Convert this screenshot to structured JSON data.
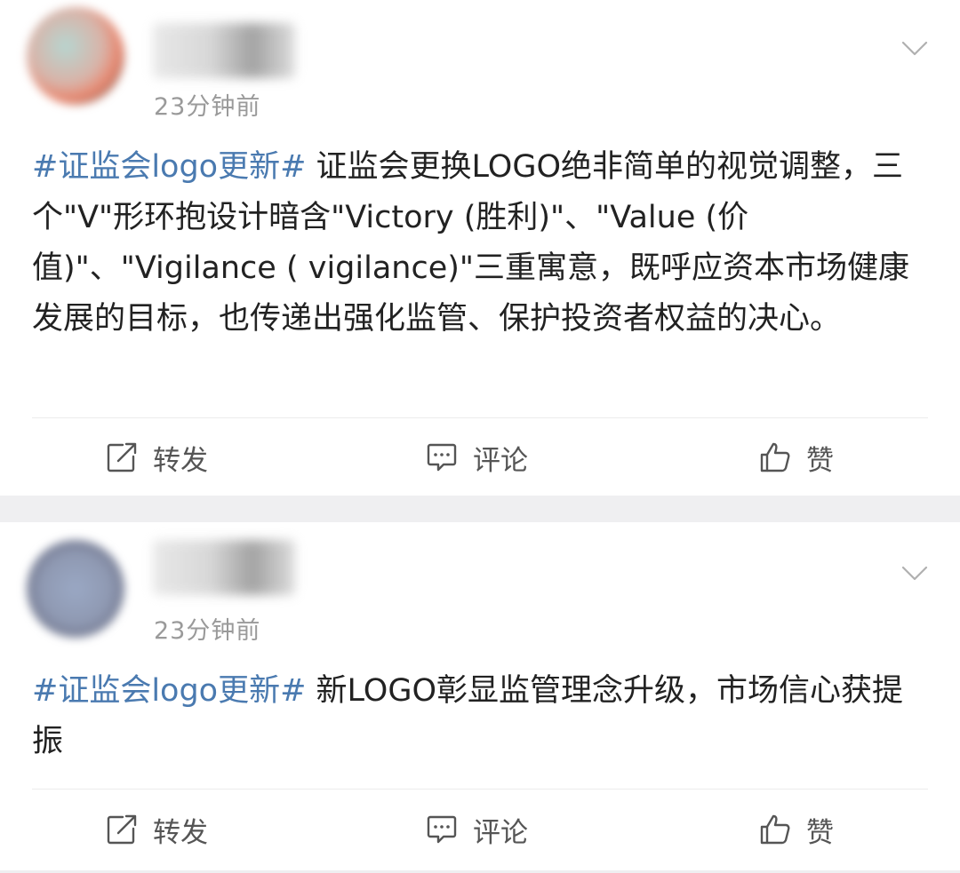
{
  "posts": [
    {
      "timestamp": "23分钟前",
      "hashtag": "#证监会logo更新#",
      "text": " 证监会更换LOGO绝非简单的视觉调整，三个\"V\"形环抱设计暗含\"Victory (胜利)\"、\"Value (价值)\"、\"Vigilance ( vigilance)\"三重寓意，既呼应资本市场健康发展的目标，也传递出强化监管、保护投资者权益的决心。",
      "actions": {
        "repost": "转发",
        "comment": "评论",
        "like": "赞"
      }
    },
    {
      "timestamp": "23分钟前",
      "hashtag": "#证监会logo更新#",
      "text": " 新LOGO彰显监管理念升级，市场信心获提振",
      "actions": {
        "repost": "转发",
        "comment": "评论",
        "like": "赞"
      }
    }
  ],
  "icons": {
    "repost": "repost-icon",
    "comment": "comment-icon",
    "like": "like-icon",
    "menu": "chevron-down-icon"
  },
  "colors": {
    "hashtag": "#4a7ab0",
    "text": "#222222",
    "meta": "#9a9a9a",
    "separator": "#efeff1"
  }
}
